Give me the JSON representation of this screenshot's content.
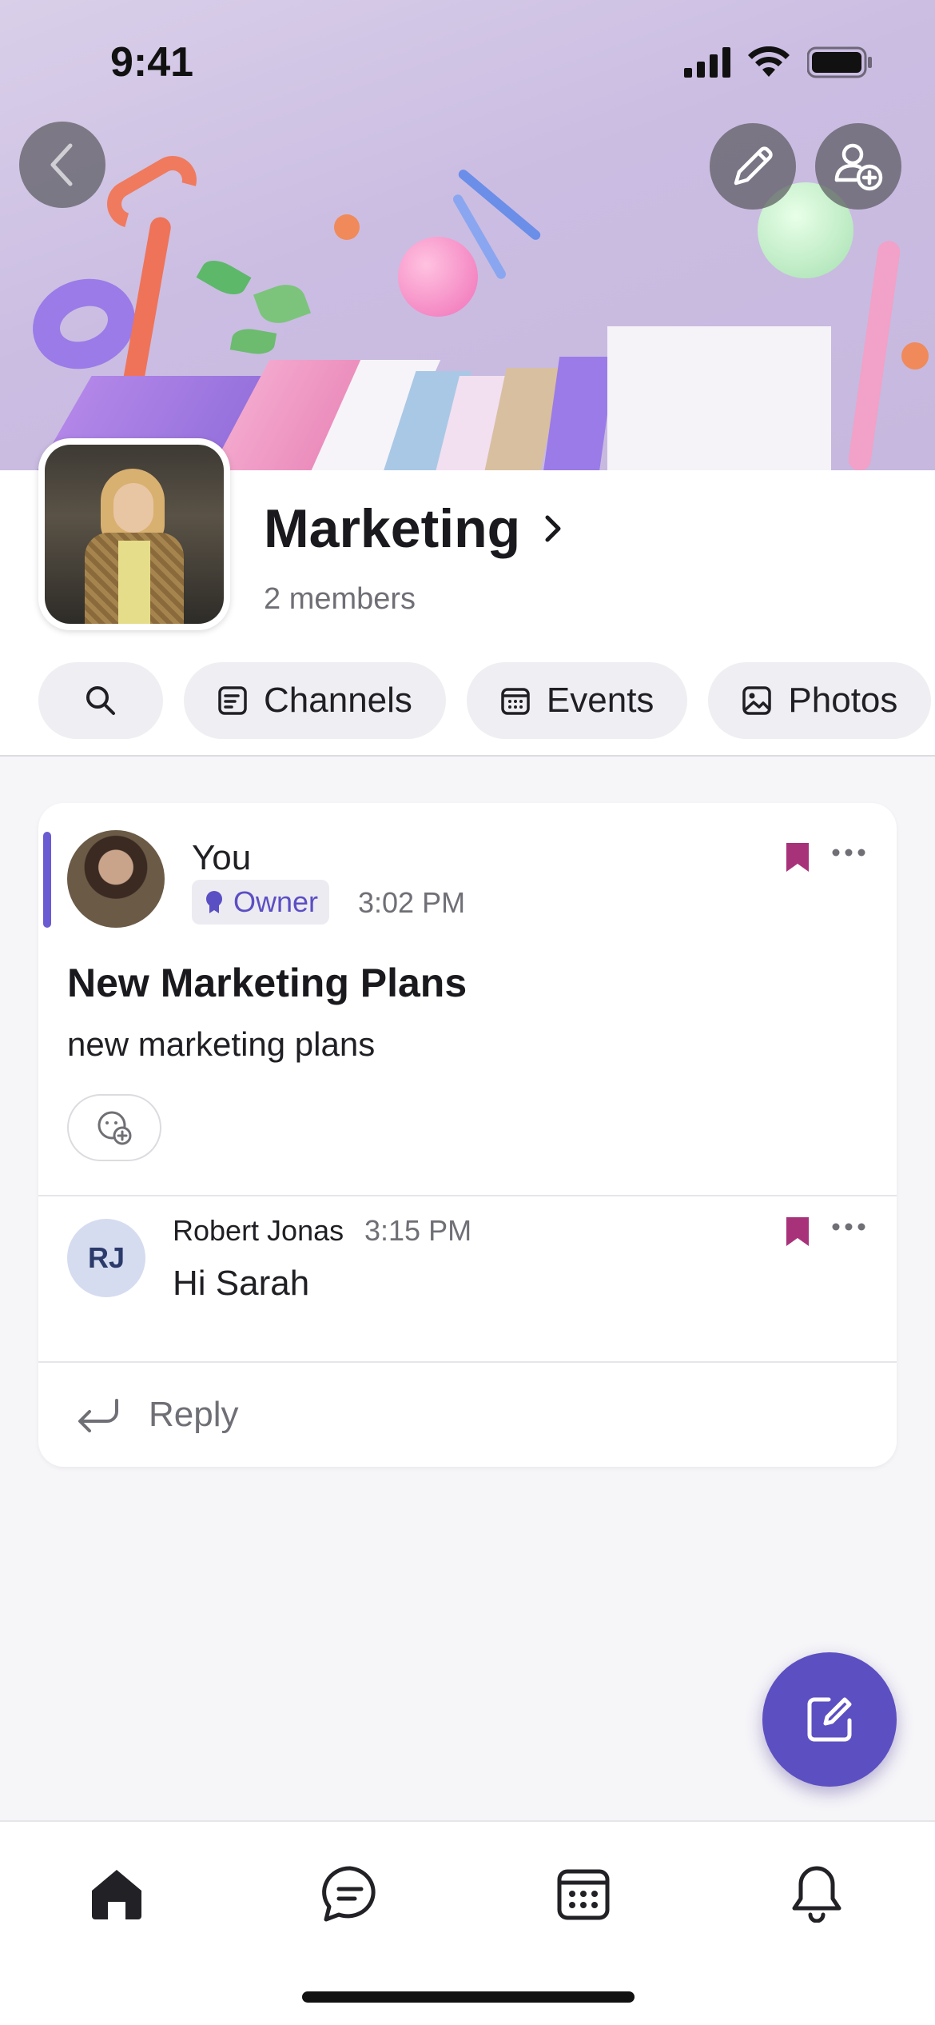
{
  "status_bar": {
    "time": "9:41"
  },
  "group": {
    "name": "Marketing",
    "members": "2 members"
  },
  "chips": [
    {
      "label": "",
      "icon": "search-icon"
    },
    {
      "label": "Channels",
      "icon": "channels-icon"
    },
    {
      "label": "Events",
      "icon": "calendar-icon"
    },
    {
      "label": "Photos",
      "icon": "image-icon"
    }
  ],
  "post": {
    "author": "You",
    "role": "Owner",
    "time": "3:02 PM",
    "title": "New Marketing Plans",
    "body": "new marketing plans"
  },
  "reply": {
    "initials": "RJ",
    "name": "Robert Jonas",
    "time": "3:15 PM",
    "text": "Hi Sarah",
    "reply_label": "Reply"
  },
  "colors": {
    "accent": "#5c4fc2",
    "bookmark": "#a8327a",
    "owner_text": "#5b4fc4"
  },
  "tabs": [
    "home-icon",
    "chat-icon",
    "calendar-icon",
    "bell-icon"
  ]
}
